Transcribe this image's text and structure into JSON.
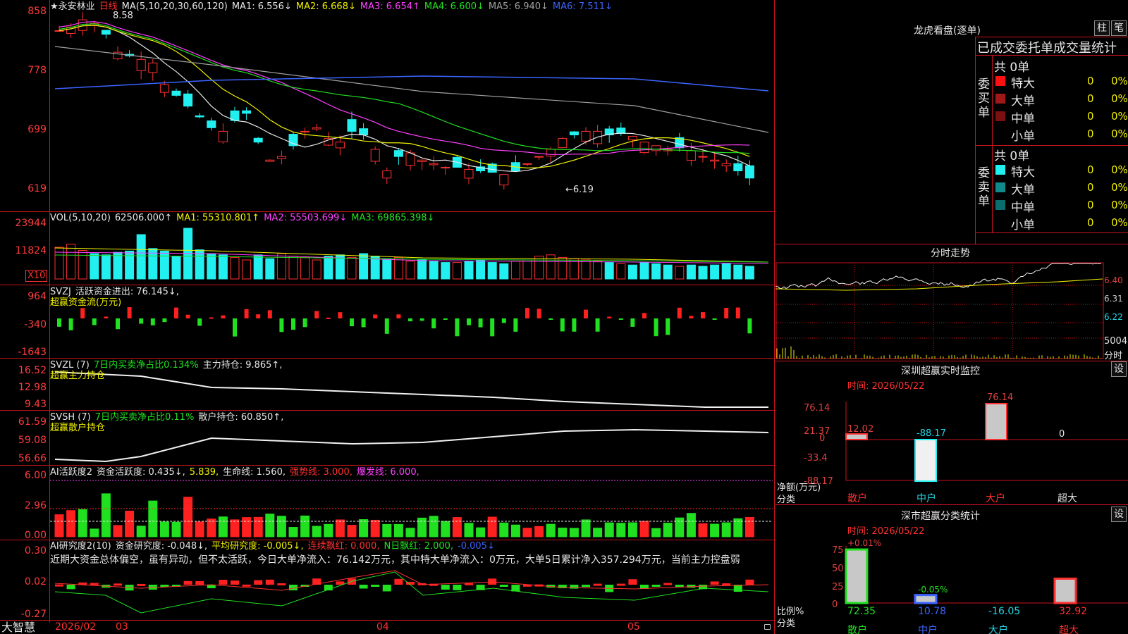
{
  "kline": {
    "title": "★永安林业",
    "period": "日线",
    "ma_spec": "MA(5,10,20,30,60,120)",
    "ma": [
      {
        "label": "MA1: 6.556↓",
        "color": "#e6e6e6"
      },
      {
        "label": "MA2: 6.668↓",
        "color": "#f0f000"
      },
      {
        "label": "MA3: 6.654↑",
        "color": "#ff40ff"
      },
      {
        "label": "MA4: 6.600↓",
        "color": "#20e020"
      },
      {
        "label": "MA5: 6.940↓",
        "color": "#a0a0a0"
      },
      {
        "label": "MA6: 7.511↓",
        "color": "#3c64ff"
      }
    ],
    "y_ticks": [
      "858",
      "778",
      "699",
      "619"
    ],
    "high_label": "8.58",
    "low_label": "←6.19"
  },
  "vol": {
    "spec": "VOL(5,10,20)",
    "value": "62506.000↑",
    "ma1": "MA1: 55310.801↑",
    "ma2": "MA2: 55503.699↓",
    "ma3": "MA3: 69865.398↓",
    "y_ticks": [
      "23944",
      "11824"
    ],
    "unit": "X10"
  },
  "svzj": {
    "name": "SVZJ",
    "line": "活跃资金进出: 76.145↓,",
    "sub": "超赢资金流(万元)",
    "y_ticks": [
      "964",
      "-340",
      "-1643"
    ]
  },
  "svzl": {
    "name": "SVZL (7)",
    "pct": "7日内买卖净占比0.134%",
    "hold": "主力持仓: 9.865↑,",
    "sub": "超赢主力持仓",
    "y_ticks": [
      "16.52",
      "12.98",
      "9.43"
    ]
  },
  "svsh": {
    "name": "SVSH (7)",
    "pct": "7日内买卖净占比0.11%",
    "hold": "散户持仓: 60.850↑,",
    "sub": "超赢散户持仓",
    "y_ticks": [
      "61.59",
      "59.08",
      "56.66"
    ]
  },
  "ai_active": {
    "name": "AI活跃度2",
    "a": "资金活跃度: 0.435↓,",
    "b": "5.839,",
    "c": "生命线: 1.560,",
    "d": "强势线: 3.000,",
    "e": "爆发线: 6.000,",
    "y_ticks": [
      "6.00",
      "2.96",
      "0.00"
    ]
  },
  "ai_research": {
    "name": "AI研究度2(10)",
    "a": "资金研究度: -0.048↓,",
    "b": "平均研究度: -0.005↓,",
    "c": "连续飘红: 0.000,",
    "d": "N日飘红: 2.000,",
    "e": "-0.005↓",
    "comment": "近期大资金总体偏空，虽有异动，但不太活跃，今日大单净流入：76.142万元，其中特大单净流入：0万元，大单5日累计净入357.294万元，当前主力控盘弱",
    "y_ticks": [
      "0.30",
      "0.02",
      "-0.27"
    ]
  },
  "footer": {
    "brand": "大智慧",
    "dates": [
      "2026/02",
      "03",
      "04",
      "05"
    ]
  },
  "dragon": {
    "title": "龙虎看盘(逐单)",
    "btn1": "柱",
    "btn2": "笔",
    "subtitle": "已成交委托单成交量统计",
    "buy_label": "委买单",
    "sell_label": "委卖单",
    "buy_total": "共 0单",
    "sell_total": "共 0单",
    "buy_rows": [
      {
        "name": "特大",
        "v": "0",
        "p": "0%",
        "color": "#ff1010"
      },
      {
        "name": "大单",
        "v": "0",
        "p": "0%",
        "color": "#a01818"
      },
      {
        "name": "中单",
        "v": "0",
        "p": "0%",
        "color": "#7a1010"
      },
      {
        "name": "小单",
        "v": "0",
        "p": "0%",
        "color": ""
      }
    ],
    "sell_rows": [
      {
        "name": "特大",
        "v": "0",
        "p": "0%",
        "color": "#22f0f0"
      },
      {
        "name": "大单",
        "v": "0",
        "p": "0%",
        "color": "#108a8a"
      },
      {
        "name": "中单",
        "v": "0",
        "p": "0%",
        "color": "#0a6e6e"
      },
      {
        "name": "小单",
        "v": "0",
        "p": "0%",
        "color": ""
      }
    ]
  },
  "intraday": {
    "title": "分时走势",
    "ticks": [
      "6.40",
      "6.31",
      "6.22"
    ],
    "vol_tick": "5004",
    "vol_label": "分时"
  },
  "sz_monitor": {
    "title": "深圳超赢实时监控",
    "btn": "设",
    "time": "时间: 2026/05/22",
    "y_ticks": [
      "76.14",
      "21.37",
      "0",
      "-33.4",
      "-88.17"
    ],
    "axis_label1": "净额(万元)",
    "axis_label2": "分类",
    "bar_labels": [
      "12.02",
      "-88.17",
      "76.14",
      "0"
    ],
    "categories": [
      "散户",
      "中户",
      "大户",
      "超大"
    ]
  },
  "sz_stats": {
    "title": "深市超赢分类统计",
    "btn": "设",
    "time": "时间: 2026/05/22",
    "y_ticks": [
      "75",
      "50",
      "25",
      "0"
    ],
    "axis_label1": "比例%",
    "axis_label2": "分类",
    "top_labels": [
      "+0.01%",
      "-0.05%"
    ],
    "values": [
      "72.35",
      "10.78",
      "-16.05",
      "32.92"
    ],
    "categories": [
      "散户",
      "中户",
      "大户",
      "超大"
    ]
  }
}
